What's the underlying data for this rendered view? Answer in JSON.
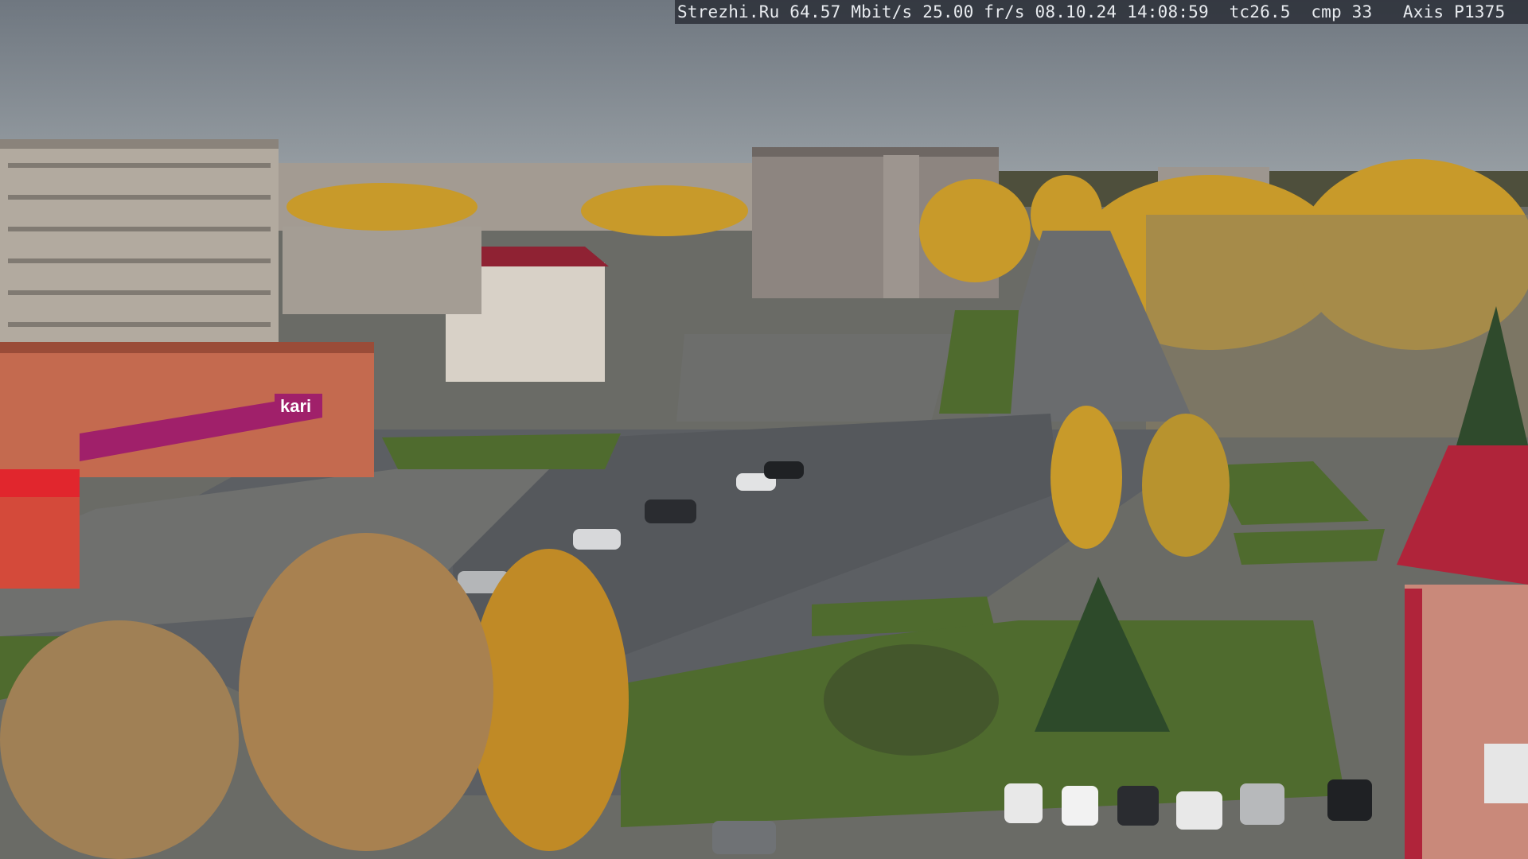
{
  "osd": {
    "site": "Strezhi.Ru",
    "bitrate": "64.57 Mbit/s",
    "framerate": "25.00 fr/s",
    "date": "08.10.24",
    "time": "14:08:59",
    "tc": "tc26.5",
    "cmp": "cmp 33",
    "camera": "Axis P1375"
  },
  "signs": {
    "store_logo": "kari",
    "store_banner": "kari"
  },
  "colors": {
    "sky": "#8a9299",
    "asphalt": "#5a5d61",
    "grass": "#4f6b2e",
    "autumn_birch": "#c89a2a",
    "store_magenta": "#a0206a",
    "roof_red": "#b0243a"
  }
}
